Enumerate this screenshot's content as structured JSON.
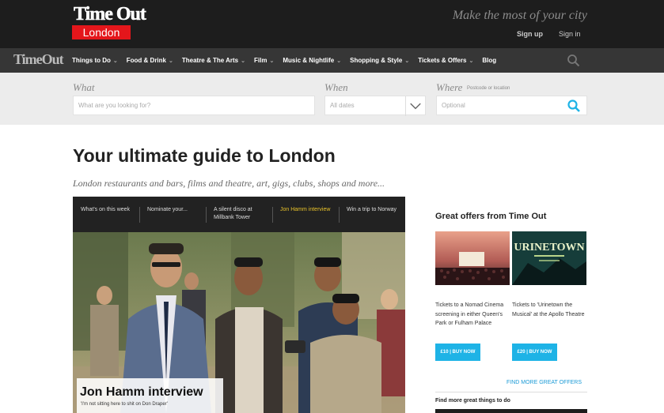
{
  "header": {
    "logo_text": "Time Out",
    "city": "London",
    "tagline": "Make the most of your city",
    "sign_up": "Sign up",
    "sign_in": "Sign in"
  },
  "nav": {
    "logo_text": "TimeOut",
    "items": [
      {
        "label": "Things to Do",
        "dropdown": true
      },
      {
        "label": "Food & Drink",
        "dropdown": true
      },
      {
        "label": "Theatre & The Arts",
        "dropdown": true
      },
      {
        "label": "Film",
        "dropdown": true
      },
      {
        "label": "Music & Nightlife",
        "dropdown": true
      },
      {
        "label": "Shopping & Style",
        "dropdown": true
      },
      {
        "label": "Tickets & Offers",
        "dropdown": true
      },
      {
        "label": "Blog",
        "dropdown": false
      }
    ]
  },
  "search": {
    "what_label": "What",
    "what_placeholder": "What are you looking for?",
    "when_label": "When",
    "when_value": "All dates",
    "where_label": "Where",
    "where_sublabel": "Postcode or location",
    "where_placeholder": "Optional"
  },
  "main": {
    "headline": "Your ultimate guide to London",
    "subheadline": "London restaurants and bars, films and theatre, art, gigs, clubs, shops and more..."
  },
  "feature": {
    "tabs": [
      {
        "label": "What's on this week",
        "active": false
      },
      {
        "label": "Nominate your...",
        "active": false
      },
      {
        "label": "A silent disco at Millbank Tower",
        "active": false
      },
      {
        "label": "Jon Hamm interview",
        "active": true
      },
      {
        "label": "Win a trip to Norway",
        "active": false
      }
    ],
    "caption_title": "Jon Hamm interview",
    "caption_sub": "'I'm not sitting here to shit on Don Draper'"
  },
  "offers": {
    "title": "Great offers from Time Out",
    "items": [
      {
        "text": "Tickets to a Nomad Cinema screening in either Queen's Park or Fulham Palace",
        "button": "£10 | BUY NOW"
      },
      {
        "text": "Tickets to 'Urinetown the Musical' at the Apollo Theatre",
        "button": "£20 | BUY NOW"
      }
    ],
    "poster_word": "URINETOWN",
    "more_link": "FIND MORE GREAT OFFERS",
    "find_more": "Find more great things to do"
  },
  "colors": {
    "topbar": "#1d1d1d",
    "navbar": "#363636",
    "brand_red": "#e4161b",
    "accent_blue": "#1eb3e6",
    "active_tab": "#e8c22a"
  }
}
